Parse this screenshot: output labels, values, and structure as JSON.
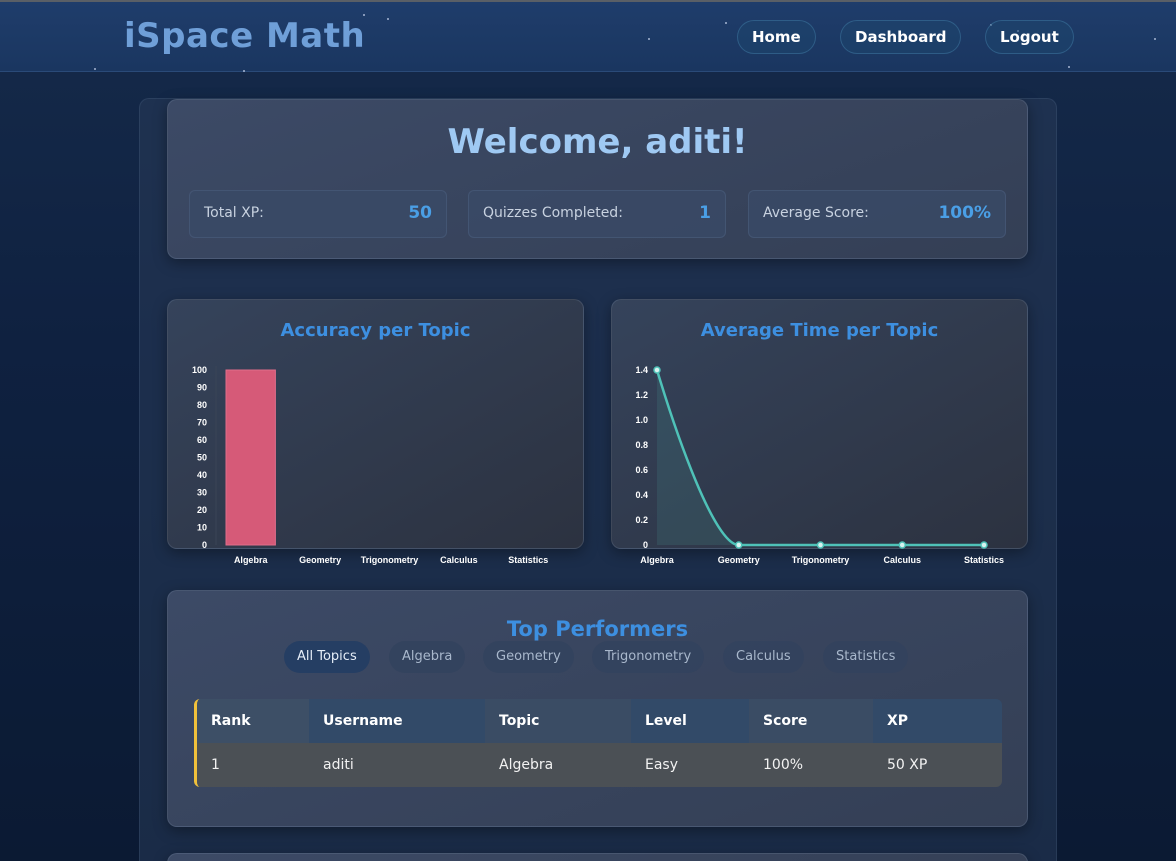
{
  "app": {
    "brand": "iSpace Math"
  },
  "nav": {
    "home": "Home",
    "dashboard": "Dashboard",
    "logout": "Logout"
  },
  "welcome": {
    "title": "Welcome, aditi!",
    "stats": [
      {
        "label": "Total XP:",
        "value": "50"
      },
      {
        "label": "Quizzes Completed:",
        "value": "1"
      },
      {
        "label": "Average Score:",
        "value": "100%"
      }
    ]
  },
  "charts": {
    "accuracy_title": "Accuracy per Topic",
    "time_title": "Average Time per Topic"
  },
  "chart_data": [
    {
      "type": "bar",
      "title": "Accuracy per Topic",
      "categories": [
        "Algebra",
        "Geometry",
        "Trigonometry",
        "Calculus",
        "Statistics"
      ],
      "values": [
        100,
        0,
        0,
        0,
        0
      ],
      "ylim": [
        0,
        100
      ],
      "yticks": [
        "0",
        "10",
        "20",
        "30",
        "40",
        "50",
        "60",
        "70",
        "80",
        "90",
        "100"
      ],
      "color": "#d65a78"
    },
    {
      "type": "line",
      "title": "Average Time per Topic",
      "categories": [
        "Algebra",
        "Geometry",
        "Trigonometry",
        "Calculus",
        "Statistics"
      ],
      "values": [
        1.4,
        0,
        0,
        0,
        0
      ],
      "ylim": [
        0,
        1.4
      ],
      "yticks": [
        "0",
        "0.2",
        "0.4",
        "0.6",
        "0.8",
        "1.0",
        "1.2",
        "1.4"
      ],
      "color": "#4fc2b8"
    }
  ],
  "performers": {
    "title": "Top Performers",
    "tabs": [
      "All Topics",
      "Algebra",
      "Geometry",
      "Trigonometry",
      "Calculus",
      "Statistics"
    ],
    "active_tab": "All Topics",
    "headers": [
      "Rank",
      "Username",
      "Topic",
      "Level",
      "Score",
      "XP"
    ],
    "rows": [
      [
        "1",
        "aditi",
        "Algebra",
        "Easy",
        "100%",
        "50 XP"
      ]
    ]
  }
}
